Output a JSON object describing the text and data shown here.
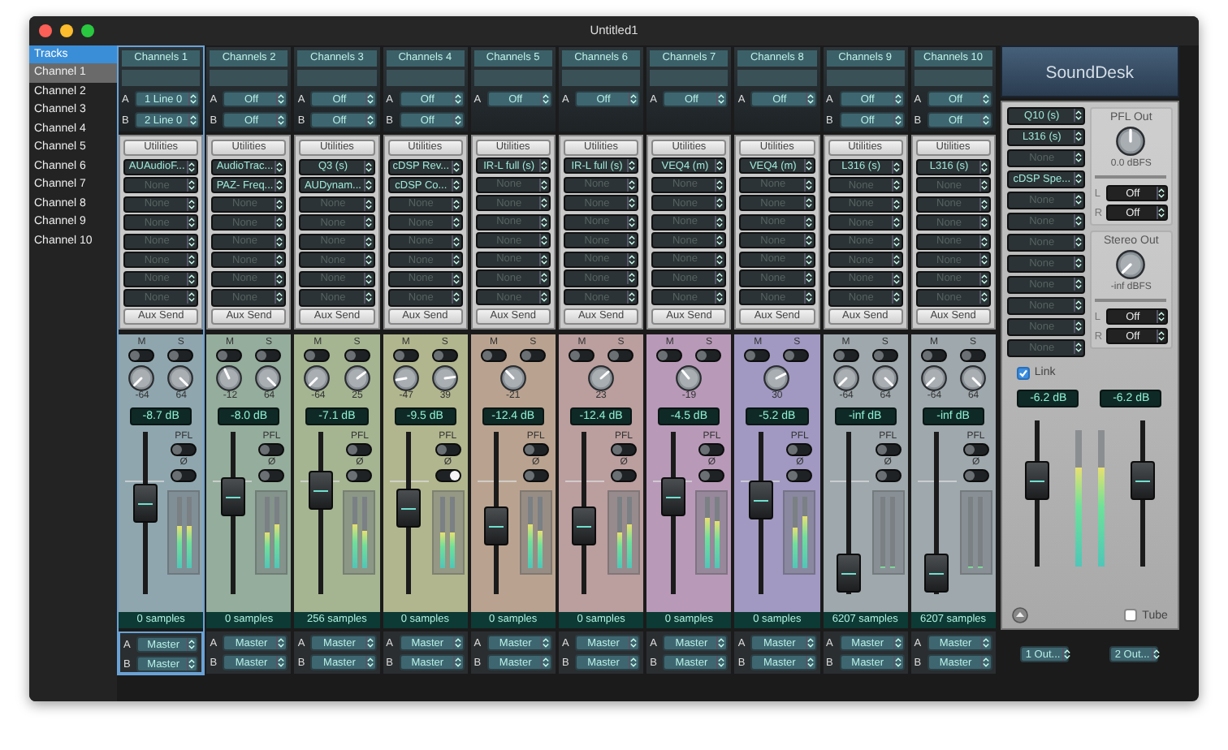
{
  "window": {
    "title": "Untitled1"
  },
  "sidebar": {
    "header": "Tracks",
    "items": [
      {
        "label": "Channel 1",
        "selected": true
      },
      {
        "label": "Channel 2",
        "selected": false
      },
      {
        "label": "Channel 3",
        "selected": false
      },
      {
        "label": "Channel 4",
        "selected": false
      },
      {
        "label": "Channel 5",
        "selected": false
      },
      {
        "label": "Channel 6",
        "selected": false
      },
      {
        "label": "Channel 7",
        "selected": false
      },
      {
        "label": "Channel 8",
        "selected": false
      },
      {
        "label": "Channel 9",
        "selected": false
      },
      {
        "label": "Channel 10",
        "selected": false
      }
    ]
  },
  "strips": [
    {
      "name": "Channels 1",
      "selected": true,
      "color": "#8fa6ae",
      "inputs": [
        {
          "bus": "A",
          "value": "1 Line 0"
        },
        {
          "bus": "B",
          "value": "2 Line 0"
        }
      ],
      "utilities": "Utilities",
      "inserts": [
        {
          "label": "AUAudioF...",
          "active": true
        },
        {
          "label": "None",
          "active": false
        },
        {
          "label": "None",
          "active": false
        },
        {
          "label": "None",
          "active": false
        },
        {
          "label": "None",
          "active": false
        },
        {
          "label": "None",
          "active": false
        },
        {
          "label": "None",
          "active": false
        },
        {
          "label": "None",
          "active": false
        }
      ],
      "aux": "Aux Send",
      "mute_label": "M",
      "solo_label": "S",
      "mute": false,
      "solo": false,
      "knobs": [
        {
          "reading": "-64"
        },
        {
          "reading": "64"
        }
      ],
      "gain": "-8.7 dB",
      "fader": {
        "level": 0.56
      },
      "pfl_label": "PFL",
      "pfl": false,
      "phase_label": "Ø",
      "phase": false,
      "meters": [
        {
          "level": 0.6
        },
        {
          "level": 0.6
        }
      ],
      "latency": "0 samples",
      "outputs": [
        {
          "bus": "A",
          "value": "Master"
        },
        {
          "bus": "B",
          "value": "Master"
        }
      ]
    },
    {
      "name": "Channels 2",
      "selected": false,
      "color": "#95ad9c",
      "inputs": [
        {
          "bus": "A",
          "value": "Off"
        },
        {
          "bus": "B",
          "value": "Off"
        }
      ],
      "utilities": "Utilities",
      "inserts": [
        {
          "label": "AudioTrac...",
          "active": true
        },
        {
          "label": "PAZ- Freq...",
          "active": true
        },
        {
          "label": "None",
          "active": false
        },
        {
          "label": "None",
          "active": false
        },
        {
          "label": "None",
          "active": false
        },
        {
          "label": "None",
          "active": false
        },
        {
          "label": "None",
          "active": false
        },
        {
          "label": "None",
          "active": false
        }
      ],
      "aux": "Aux Send",
      "mute_label": "M",
      "solo_label": "S",
      "mute": false,
      "solo": false,
      "knobs": [
        {
          "reading": "-12"
        },
        {
          "reading": "64"
        }
      ],
      "gain": "-8.0 dB",
      "fader": {
        "level": 0.6
      },
      "pfl_label": "PFL",
      "pfl": false,
      "phase_label": "Ø",
      "phase": false,
      "meters": [
        {
          "level": 0.5
        },
        {
          "level": 0.62
        }
      ],
      "latency": "0 samples",
      "outputs": [
        {
          "bus": "A",
          "value": "Master"
        },
        {
          "bus": "B",
          "value": "Master"
        }
      ]
    },
    {
      "name": "Channels 3",
      "selected": false,
      "color": "#a5b592",
      "inputs": [
        {
          "bus": "A",
          "value": "Off"
        },
        {
          "bus": "B",
          "value": "Off"
        }
      ],
      "utilities": "Utilities",
      "inserts": [
        {
          "label": "Q3 (s)",
          "active": true
        },
        {
          "label": "AUDynam...",
          "active": true
        },
        {
          "label": "None",
          "active": false
        },
        {
          "label": "None",
          "active": false
        },
        {
          "label": "None",
          "active": false
        },
        {
          "label": "None",
          "active": false
        },
        {
          "label": "None",
          "active": false
        },
        {
          "label": "None",
          "active": false
        }
      ],
      "aux": "Aux Send",
      "mute_label": "M",
      "solo_label": "S",
      "mute": false,
      "solo": false,
      "knobs": [
        {
          "reading": "-64"
        },
        {
          "reading": "25"
        }
      ],
      "gain": "-7.1 dB",
      "fader": {
        "level": 0.64
      },
      "pfl_label": "PFL",
      "pfl": false,
      "phase_label": "Ø",
      "phase": false,
      "meters": [
        {
          "level": 0.62
        },
        {
          "level": 0.52
        }
      ],
      "latency": "256 samples",
      "outputs": [
        {
          "bus": "A",
          "value": "Master"
        },
        {
          "bus": "B",
          "value": "Master"
        }
      ]
    },
    {
      "name": "Channels 4",
      "selected": false,
      "color": "#b2b68e",
      "inputs": [
        {
          "bus": "A",
          "value": "Off"
        },
        {
          "bus": "B",
          "value": "Off"
        }
      ],
      "utilities": "Utilities",
      "inserts": [
        {
          "label": "cDSP Rev...",
          "active": true
        },
        {
          "label": "cDSP Co...",
          "active": true
        },
        {
          "label": "None",
          "active": false
        },
        {
          "label": "None",
          "active": false
        },
        {
          "label": "None",
          "active": false
        },
        {
          "label": "None",
          "active": false
        },
        {
          "label": "None",
          "active": false
        },
        {
          "label": "None",
          "active": false
        }
      ],
      "aux": "Aux Send",
      "mute_label": "M",
      "solo_label": "S",
      "mute": false,
      "solo": false,
      "knobs": [
        {
          "reading": "-47"
        },
        {
          "reading": "39"
        }
      ],
      "gain": "-9.5 dB",
      "fader": {
        "level": 0.53
      },
      "pfl_label": "PFL",
      "pfl": false,
      "phase_label": "Ø",
      "phase": true,
      "meters": [
        {
          "level": 0.5
        },
        {
          "level": 0.5
        }
      ],
      "latency": "0 samples",
      "outputs": [
        {
          "bus": "A",
          "value": "Master"
        },
        {
          "bus": "B",
          "value": "Master"
        }
      ]
    },
    {
      "name": "Channels 5",
      "selected": false,
      "color": "#b9a390",
      "inputs": [
        {
          "bus": "A",
          "value": "Off"
        }
      ],
      "utilities": "Utilities",
      "inserts": [
        {
          "label": "IR-L full (s)",
          "active": true
        },
        {
          "label": "None",
          "active": false
        },
        {
          "label": "None",
          "active": false
        },
        {
          "label": "None",
          "active": false
        },
        {
          "label": "None",
          "active": false
        },
        {
          "label": "None",
          "active": false
        },
        {
          "label": "None",
          "active": false
        },
        {
          "label": "None",
          "active": false
        }
      ],
      "aux": "Aux Send",
      "mute_label": "M",
      "solo_label": "S",
      "mute": false,
      "solo": false,
      "knobs": [
        {
          "reading": "-21"
        }
      ],
      "gain": "-12.4 dB",
      "fader": {
        "level": 0.42
      },
      "pfl_label": "PFL",
      "pfl": false,
      "phase_label": "Ø",
      "phase": false,
      "meters": [
        {
          "level": 0.6
        },
        {
          "level": 0.52
        }
      ],
      "latency": "0 samples",
      "outputs": [
        {
          "bus": "A",
          "value": "Master"
        },
        {
          "bus": "B",
          "value": "Master"
        }
      ]
    },
    {
      "name": "Channels 6",
      "selected": false,
      "color": "#bb9e9e",
      "inputs": [
        {
          "bus": "A",
          "value": "Off"
        }
      ],
      "utilities": "Utilities",
      "inserts": [
        {
          "label": "IR-L full (s)",
          "active": true
        },
        {
          "label": "None",
          "active": false
        },
        {
          "label": "None",
          "active": false
        },
        {
          "label": "None",
          "active": false
        },
        {
          "label": "None",
          "active": false
        },
        {
          "label": "None",
          "active": false
        },
        {
          "label": "None",
          "active": false
        },
        {
          "label": "None",
          "active": false
        }
      ],
      "aux": "Aux Send",
      "mute_label": "M",
      "solo_label": "S",
      "mute": false,
      "solo": false,
      "knobs": [
        {
          "reading": "23"
        }
      ],
      "gain": "-12.4 dB",
      "fader": {
        "level": 0.42
      },
      "pfl_label": "PFL",
      "pfl": false,
      "phase_label": "Ø",
      "phase": false,
      "meters": [
        {
          "level": 0.5
        },
        {
          "level": 0.6
        }
      ],
      "latency": "0 samples",
      "outputs": [
        {
          "bus": "A",
          "value": "Master"
        },
        {
          "bus": "B",
          "value": "Master"
        }
      ]
    },
    {
      "name": "Channels 7",
      "selected": false,
      "color": "#b89ab8",
      "inputs": [
        {
          "bus": "A",
          "value": "Off"
        }
      ],
      "utilities": "Utilities",
      "inserts": [
        {
          "label": "VEQ4 (m)",
          "active": true
        },
        {
          "label": "None",
          "active": false
        },
        {
          "label": "None",
          "active": false
        },
        {
          "label": "None",
          "active": false
        },
        {
          "label": "None",
          "active": false
        },
        {
          "label": "None",
          "active": false
        },
        {
          "label": "None",
          "active": false
        },
        {
          "label": "None",
          "active": false
        }
      ],
      "aux": "Aux Send",
      "mute_label": "M",
      "solo_label": "S",
      "mute": false,
      "solo": false,
      "knobs": [
        {
          "reading": "-19"
        }
      ],
      "gain": "-4.5 dB",
      "fader": {
        "level": 0.6
      },
      "pfl_label": "PFL",
      "pfl": false,
      "phase_label": "Ø",
      "phase": false,
      "meters": [
        {
          "level": 0.7
        },
        {
          "level": 0.65
        }
      ],
      "latency": "0 samples",
      "outputs": [
        {
          "bus": "A",
          "value": "Master"
        },
        {
          "bus": "B",
          "value": "Master"
        }
      ]
    },
    {
      "name": "Channels 8",
      "selected": false,
      "color": "#a199c2",
      "inputs": [
        {
          "bus": "A",
          "value": "Off"
        }
      ],
      "utilities": "Utilities",
      "inserts": [
        {
          "label": "VEQ4 (m)",
          "active": true
        },
        {
          "label": "None",
          "active": false
        },
        {
          "label": "None",
          "active": false
        },
        {
          "label": "None",
          "active": false
        },
        {
          "label": "None",
          "active": false
        },
        {
          "label": "None",
          "active": false
        },
        {
          "label": "None",
          "active": false
        },
        {
          "label": "None",
          "active": false
        }
      ],
      "aux": "Aux Send",
      "mute_label": "M",
      "solo_label": "S",
      "mute": false,
      "solo": false,
      "knobs": [
        {
          "reading": "30"
        }
      ],
      "gain": "-5.2 dB",
      "fader": {
        "level": 0.58
      },
      "pfl_label": "PFL",
      "pfl": false,
      "phase_label": "Ø",
      "phase": false,
      "meters": [
        {
          "level": 0.55
        },
        {
          "level": 0.72
        }
      ],
      "latency": "0 samples",
      "outputs": [
        {
          "bus": "A",
          "value": "Master"
        },
        {
          "bus": "B",
          "value": "Master"
        }
      ]
    },
    {
      "name": "Channels 9",
      "selected": false,
      "color": "#9ea8ad",
      "inputs": [
        {
          "bus": "A",
          "value": "Off"
        },
        {
          "bus": "B",
          "value": "Off"
        }
      ],
      "utilities": "Utilities",
      "inserts": [
        {
          "label": "L316 (s)",
          "active": true
        },
        {
          "label": "None",
          "active": false
        },
        {
          "label": "None",
          "active": false
        },
        {
          "label": "None",
          "active": false
        },
        {
          "label": "None",
          "active": false
        },
        {
          "label": "None",
          "active": false
        },
        {
          "label": "None",
          "active": false
        },
        {
          "label": "None",
          "active": false
        }
      ],
      "aux": "Aux Send",
      "mute_label": "M",
      "solo_label": "S",
      "mute": false,
      "solo": false,
      "knobs": [
        {
          "reading": "-64"
        },
        {
          "reading": "64"
        }
      ],
      "gain": "-inf dB",
      "fader": {
        "level": 0.13
      },
      "pfl_label": "PFL",
      "pfl": false,
      "phase_label": "Ø",
      "phase": false,
      "meters": [
        {
          "level": 0
        },
        {
          "level": 0
        }
      ],
      "latency": "6207 samples",
      "outputs": [
        {
          "bus": "A",
          "value": "Master"
        },
        {
          "bus": "B",
          "value": "Master"
        }
      ]
    },
    {
      "name": "Channels 10",
      "selected": false,
      "color": "#9ea8ad",
      "inputs": [
        {
          "bus": "A",
          "value": "Off"
        },
        {
          "bus": "B",
          "value": "Off"
        }
      ],
      "utilities": "Utilities",
      "inserts": [
        {
          "label": "L316 (s)",
          "active": true
        },
        {
          "label": "None",
          "active": false
        },
        {
          "label": "None",
          "active": false
        },
        {
          "label": "None",
          "active": false
        },
        {
          "label": "None",
          "active": false
        },
        {
          "label": "None",
          "active": false
        },
        {
          "label": "None",
          "active": false
        },
        {
          "label": "None",
          "active": false
        }
      ],
      "aux": "Aux Send",
      "mute_label": "M",
      "solo_label": "S",
      "mute": false,
      "solo": false,
      "knobs": [
        {
          "reading": "-64"
        },
        {
          "reading": "64"
        }
      ],
      "gain": "-inf dB",
      "fader": {
        "level": 0.13
      },
      "pfl_label": "PFL",
      "pfl": false,
      "phase_label": "Ø",
      "phase": false,
      "meters": [
        {
          "level": 0
        },
        {
          "level": 0
        }
      ],
      "latency": "6207 samples",
      "outputs": [
        {
          "bus": "A",
          "value": "Master"
        },
        {
          "bus": "B",
          "value": "Master"
        }
      ]
    }
  ],
  "master": {
    "title": "SoundDesk",
    "inserts": [
      {
        "label": "Q10 (s)",
        "active": true
      },
      {
        "label": "L316 (s)",
        "active": true
      },
      {
        "label": "None",
        "active": false
      },
      {
        "label": "cDSP Spe...",
        "active": true
      },
      {
        "label": "None",
        "active": false
      },
      {
        "label": "None",
        "active": false
      },
      {
        "label": "None",
        "active": false
      },
      {
        "label": "None",
        "active": false
      },
      {
        "label": "None",
        "active": false
      },
      {
        "label": "None",
        "active": false
      },
      {
        "label": "None",
        "active": false
      },
      {
        "label": "None",
        "active": false
      }
    ],
    "pfl_out": {
      "label": "PFL Out",
      "reading": "0.0 dBFS",
      "channels": [
        {
          "bus": "L",
          "value": "Off"
        },
        {
          "bus": "R",
          "value": "Off"
        }
      ]
    },
    "stereo_out": {
      "label": "Stereo Out",
      "reading": "-inf dBFS",
      "channels": [
        {
          "bus": "L",
          "value": "Off"
        },
        {
          "bus": "R",
          "value": "Off"
        }
      ]
    },
    "link": {
      "label": "Link",
      "checked": true
    },
    "channels": [
      {
        "gain": "-6.2 dB",
        "fader": {
          "level": 0.62
        },
        "meter": {
          "level": 0.72
        }
      },
      {
        "gain": "-6.2 dB",
        "fader": {
          "level": 0.62
        },
        "meter": {
          "level": 0.72
        }
      }
    ],
    "tube": {
      "label": "Tube",
      "checked": false
    },
    "outputs": [
      "1 Out...",
      "2 Out..."
    ]
  }
}
